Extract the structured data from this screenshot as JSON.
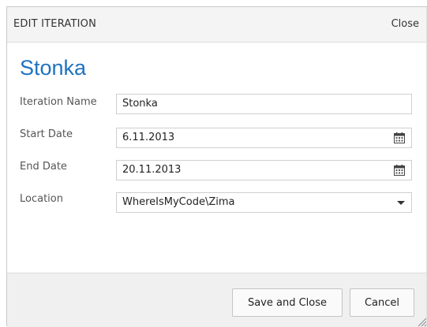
{
  "dialog": {
    "title": "EDIT ITERATION",
    "close_label": "Close",
    "heading": "Stonka"
  },
  "form": {
    "iteration_name": {
      "label": "Iteration Name",
      "value": "Stonka"
    },
    "start_date": {
      "label": "Start Date",
      "value": "6.11.2013",
      "icon": "calendar-icon"
    },
    "end_date": {
      "label": "End Date",
      "value": "20.11.2013",
      "icon": "calendar-icon"
    },
    "location": {
      "label": "Location",
      "value": "WhereIsMyCode\\Zima",
      "icon": "chevron-down-icon"
    }
  },
  "footer": {
    "save_label": "Save and Close",
    "cancel_label": "Cancel"
  },
  "colors": {
    "heading": "#1e73be",
    "titlebar_bg": "#f4f4f4",
    "footer_bg": "#f0f0f0"
  }
}
